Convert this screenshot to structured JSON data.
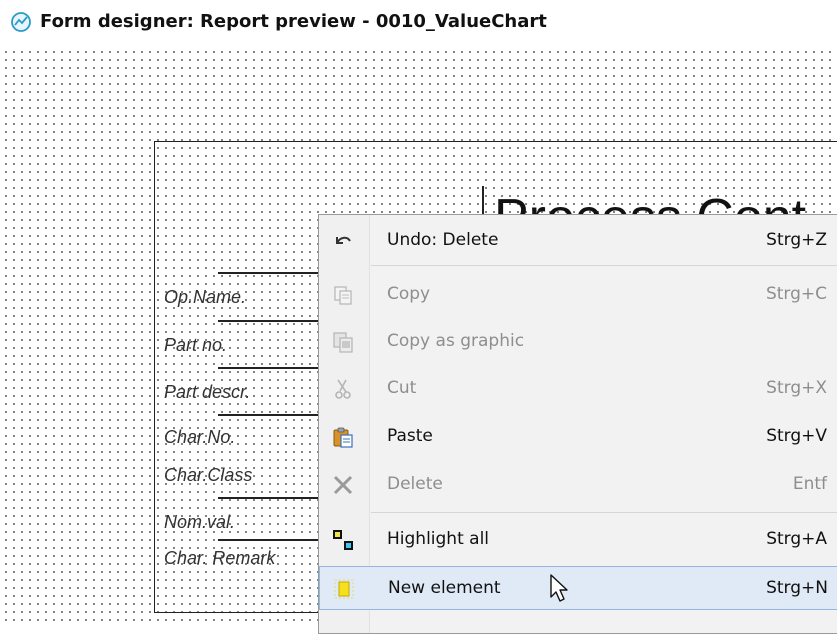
{
  "window": {
    "title": "Form designer: Report preview - 0010_ValueChart",
    "icon": "form-designer-icon"
  },
  "form": {
    "heading_fragment": "Process Cont",
    "fields": [
      "Op.Name.",
      "Part no.",
      "Part descr.",
      "Char.No.",
      "Char.Class",
      "Nom.val.",
      "Char. Remark"
    ]
  },
  "context_menu": {
    "items": [
      {
        "label": "Undo: Delete",
        "shortcut": "Strg+Z",
        "enabled": true,
        "icon": "undo-icon"
      },
      {
        "label": "Copy",
        "shortcut": "Strg+C",
        "enabled": false,
        "icon": "copy-icon"
      },
      {
        "label": "Copy as graphic",
        "shortcut": "",
        "enabled": false,
        "icon": "copy-graphic-icon"
      },
      {
        "label": "Cut",
        "shortcut": "Strg+X",
        "enabled": false,
        "icon": "scissors-icon"
      },
      {
        "label": "Paste",
        "shortcut": "Strg+V",
        "enabled": true,
        "icon": "paste-icon"
      },
      {
        "label": "Delete",
        "shortcut": "Entf",
        "enabled": false,
        "icon": "delete-x-icon"
      },
      {
        "label": "Highlight all",
        "shortcut": "Strg+A",
        "enabled": true,
        "icon": "select-all-icon"
      },
      {
        "label": "New element",
        "shortcut": "Strg+N",
        "enabled": true,
        "icon": "new-element-icon",
        "highlighted": true
      }
    ]
  },
  "colors": {
    "menu_background": "#f2f2f2",
    "highlight": "#dfeaf6",
    "highlight_border": "#8fb7e0",
    "disabled_text": "#8e8e8e"
  }
}
